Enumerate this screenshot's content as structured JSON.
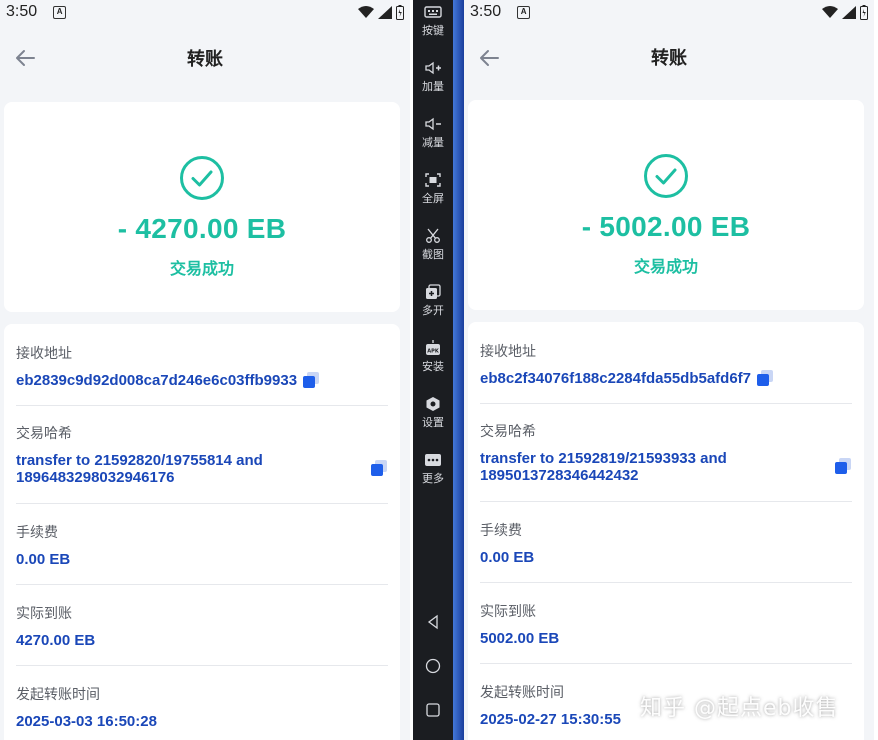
{
  "left": {
    "status": {
      "time": "3:50",
      "notif": "A"
    },
    "title": "转账",
    "amount": "- 4270.00 EB",
    "result": "交易成功",
    "details": [
      {
        "label": "接收地址",
        "value": "eb2839c9d92d008ca7d246e6c03ffb9933"
      },
      {
        "label": "交易哈希",
        "value_line1": "transfer to 21592820/19755814 and",
        "value_line2": "1896483298032946176"
      },
      {
        "label": "手续费",
        "value": "0.00 EB"
      },
      {
        "label": "实际到账",
        "value": "4270.00 EB"
      },
      {
        "label": "发起转账时间",
        "value": "2025-03-03 16:50:28"
      }
    ]
  },
  "right": {
    "status": {
      "time": "3:50",
      "notif": "A"
    },
    "title": "转账",
    "amount": "- 5002.00 EB",
    "result": "交易成功",
    "details": [
      {
        "label": "接收地址",
        "value": "eb8c2f34076f188c2284fda55db5afd6f7"
      },
      {
        "label": "交易哈希",
        "value_line1": "transfer to 21592819/21593933 and",
        "value_line2": "1895013728346442432"
      },
      {
        "label": "手续费",
        "value": "0.00 EB"
      },
      {
        "label": "实际到账",
        "value": "5002.00 EB"
      },
      {
        "label": "发起转账时间",
        "value": "2025-02-27 15:30:55"
      }
    ]
  },
  "sidebar": {
    "items": [
      "按键",
      "加量",
      "减量",
      "全屏",
      "截图",
      "多开",
      "安装",
      "设置",
      "更多"
    ]
  },
  "watermark": "知乎 @起点eb收售",
  "colors": {
    "accent": "#1dbfa2",
    "value": "#1a47b8",
    "copy_icon": "#1e5eea",
    "sidebar": "#1b1d21"
  }
}
